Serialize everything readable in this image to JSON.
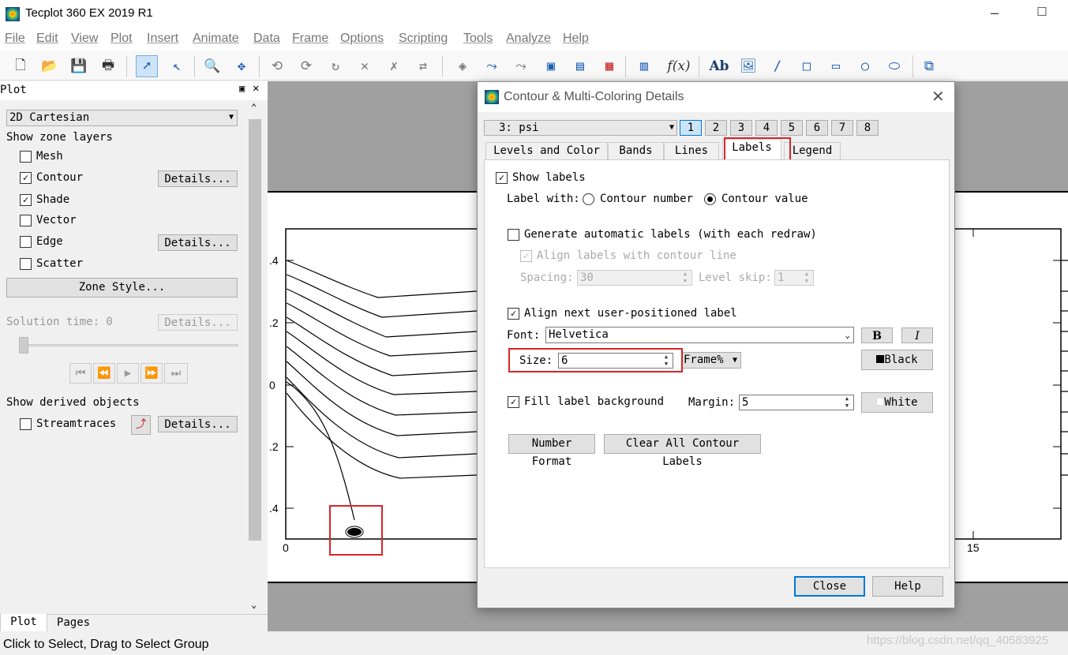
{
  "window": {
    "title": "Tecplot 360 EX 2019 R1"
  },
  "menu": [
    "File",
    "Edit",
    "View",
    "Plot",
    "Insert",
    "Animate",
    "Data",
    "Frame",
    "Options",
    "Scripting",
    "Tools",
    "Analyze",
    "Help"
  ],
  "toolbar": {
    "icons": [
      "new-layout-icon",
      "open-icon",
      "save-icon",
      "print-icon",
      "select-icon",
      "adjust-icon",
      "zoom-icon",
      "translate-icon",
      "rotate-x-icon",
      "rotate-y-icon",
      "rotate-z-icon",
      "rotate-xy-icon",
      "rotate-axis-icon",
      "rotate-roll-icon",
      "probe-icon",
      "contour-add-icon",
      "contour-remove-icon",
      "zone-add-icon",
      "zone-remove-icon",
      "contour-level-icon",
      "data-edit-icon",
      "equation-icon",
      "text-icon",
      "image-icon",
      "line-icon",
      "square-icon",
      "rectangle-icon",
      "circle-icon",
      "ellipse-icon",
      "frame-icon"
    ]
  },
  "sidepanel": {
    "header": "Plot",
    "plot_type": "2D Cartesian",
    "show_zone_layers": "Show zone layers",
    "layers": [
      {
        "label": "Mesh",
        "checked": false,
        "details": false
      },
      {
        "label": "Contour",
        "checked": true,
        "details": true
      },
      {
        "label": "Shade",
        "checked": true,
        "details": false
      },
      {
        "label": "Vector",
        "checked": false,
        "details": false
      },
      {
        "label": "Edge",
        "checked": false,
        "details": true
      },
      {
        "label": "Scatter",
        "checked": false,
        "details": false
      }
    ],
    "details_label": "Details...",
    "zone_style": "Zone Style...",
    "solution_time": "Solution time: 0",
    "show_derived": "Show derived objects",
    "streamtraces": "Streamtraces",
    "bottom_tabs": [
      "Plot",
      "Pages"
    ]
  },
  "plot": {
    "y_ticks": [
      ".4",
      ".2",
      "0",
      ".2",
      ".4"
    ],
    "x_ticks": [
      "0",
      "15"
    ]
  },
  "dialog": {
    "title": "Contour & Multi-Coloring Details",
    "variable": "3: psi",
    "group_buttons": [
      "1",
      "2",
      "3",
      "4",
      "5",
      "6",
      "7",
      "8"
    ],
    "selected_group": "1",
    "tabs": [
      "Levels and Color",
      "Bands",
      "Lines",
      "Labels",
      "Legend"
    ],
    "active_tab": "Labels",
    "show_labels": "Show labels",
    "label_with": "Label with:",
    "radio_contour_number": "Contour number",
    "radio_contour_value": "Contour value",
    "generate_auto": "Generate automatic labels (with each redraw)",
    "align_with_line": "Align labels with contour line",
    "spacing_label": "Spacing:",
    "spacing_value": "30",
    "level_skip_label": "Level skip:",
    "level_skip_value": "1",
    "align_next": "Align next user-positioned label",
    "font_label": "Font:",
    "font_value": "Helvetica",
    "bold": "B",
    "italic": "I",
    "size_label": "Size:",
    "size_value": "6",
    "size_units": "Frame%",
    "text_color": "Black",
    "fill_bg": "Fill label background",
    "margin_label": "Margin:",
    "margin_value": "5",
    "bg_color": "White",
    "number_format": "Number Format",
    "clear_labels": "Clear All Contour Labels",
    "close": "Close",
    "help": "Help"
  },
  "status": "Click to Select, Drag to Select Group",
  "watermark": "https://blog.csdn.net/qq_40583925",
  "colors": {
    "highlight_box": "#d9242a",
    "selection": "#cce4f7"
  }
}
